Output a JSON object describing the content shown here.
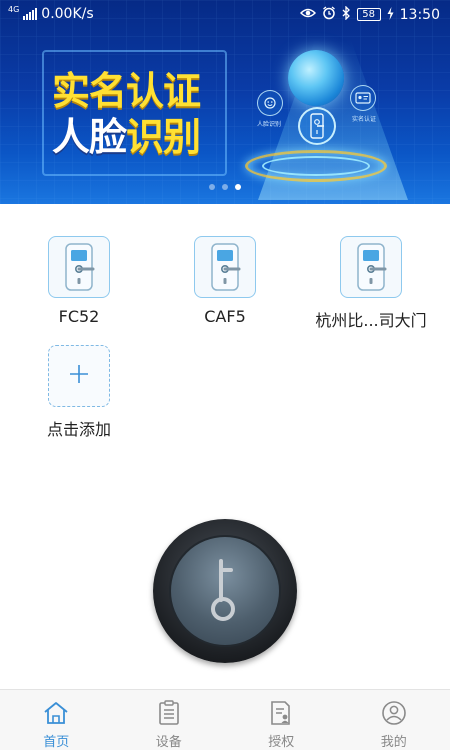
{
  "status_bar": {
    "network_type": "4G",
    "speed": "0.00K/s",
    "battery": "58",
    "time": "13:50"
  },
  "banner": {
    "title_line1": [
      "实",
      "名",
      "认",
      "证"
    ],
    "title_line2": [
      "人",
      "脸",
      "识",
      "别"
    ],
    "node_label_face": "人脸识别",
    "node_label_realname": "实名认证",
    "page_count": 3,
    "active_page": 3
  },
  "devices": [
    {
      "name": "FC52",
      "icon": "door-lock-icon"
    },
    {
      "name": "CAF5",
      "icon": "door-lock-icon"
    },
    {
      "name": "杭州比...司大门",
      "icon": "door-lock-icon"
    }
  ],
  "add_device": {
    "label": "点击添加",
    "icon": "plus-icon"
  },
  "unlock_button": {
    "icon": "key-icon"
  },
  "bottom_nav": {
    "items": [
      {
        "label": "首页",
        "icon": "home-icon",
        "active": true
      },
      {
        "label": "设备",
        "icon": "device-list-icon",
        "active": false
      },
      {
        "label": "授权",
        "icon": "authorize-doc-icon",
        "active": false
      },
      {
        "label": "我的",
        "icon": "profile-icon",
        "active": false
      }
    ]
  },
  "colors": {
    "accent": "#3a8fd6",
    "banner_blue": "#0a3ca8",
    "title_yellow": "#ffe033"
  }
}
